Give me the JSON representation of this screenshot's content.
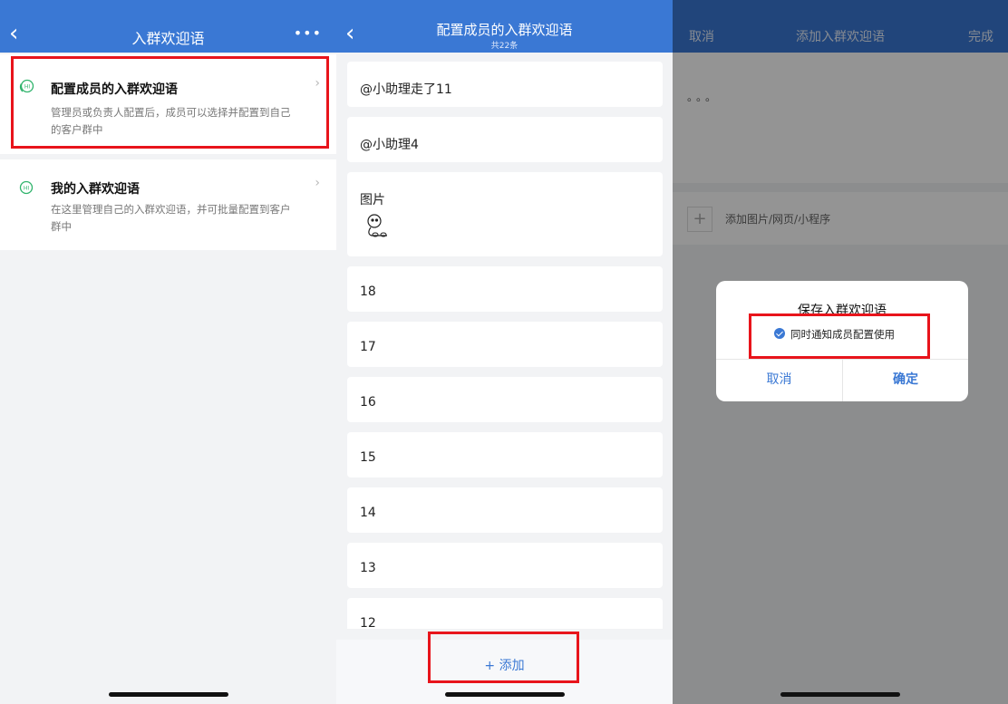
{
  "panel1": {
    "nav_title": "入群欢迎语",
    "nav_more": "•••",
    "cards": [
      {
        "title": "配置成员的入群欢迎语",
        "desc": "管理员或负责人配置后，成员可以选择并配置到自己的客户群中",
        "icon": "hi-chat-icon"
      },
      {
        "title": "我的入群欢迎语",
        "desc": "在这里管理自己的入群欢迎语，并可批量配置到客户群中",
        "icon": "hi-chat-icon"
      }
    ]
  },
  "panel2": {
    "nav_title": "配置成员的入群欢迎语",
    "nav_subtitle": "共22条",
    "items": [
      "@小助理走了11",
      "@小助理4",
      "图片",
      "18",
      "17",
      "16",
      "15",
      "14",
      "13",
      "12"
    ],
    "add_label": "+ 添加"
  },
  "panel3": {
    "cancel": "取消",
    "title": "添加入群欢迎语",
    "done": "完成",
    "editor_placeholder": "。。。",
    "attach_label": "添加图片/网页/小程序",
    "dialog": {
      "title": "保存入群欢迎语",
      "notify_label": "同时通知成员配置使用",
      "cancel": "取消",
      "confirm": "确定"
    }
  },
  "colors": {
    "brand": "#3a78d4",
    "highlight": "#e8141b",
    "icon_green": "#2fb36b"
  }
}
